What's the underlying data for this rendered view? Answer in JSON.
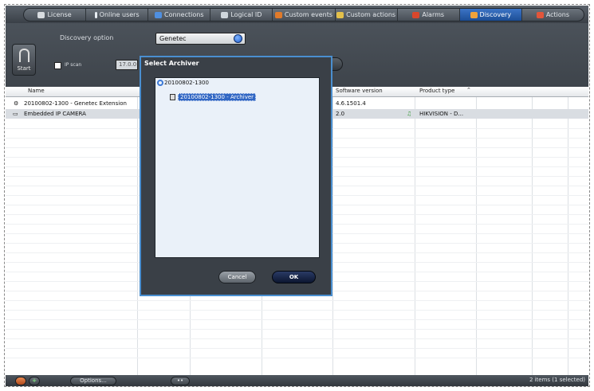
{
  "tabs": [
    {
      "label": "License",
      "icon": "license-icon",
      "color": "#d8dce0"
    },
    {
      "label": "Online users",
      "icon": "user-icon",
      "color": "#e8eef4"
    },
    {
      "label": "Connections",
      "icon": "connections-icon",
      "color": "#4f8fe0"
    },
    {
      "label": "Logical ID",
      "icon": "logical-id-icon",
      "color": "#cfd6dc"
    },
    {
      "label": "Custom events",
      "icon": "custom-events-icon",
      "color": "#e07a2a"
    },
    {
      "label": "Custom actions",
      "icon": "custom-actions-icon",
      "color": "#e3c04a"
    },
    {
      "label": "Alarms",
      "icon": "alarm-icon",
      "color": "#d9472c"
    },
    {
      "label": "Discovery",
      "icon": "discovery-icon",
      "color": "#f0a23a",
      "active": true
    },
    {
      "label": "Actions",
      "icon": "actions-icon",
      "color": "#e2553a"
    }
  ],
  "options": {
    "discovery_label": "Discovery option",
    "discovery_value": "Genetec",
    "start_label": "Start",
    "ipscan_label": "IP scan",
    "ip_field": "17.0.0"
  },
  "grid": {
    "columns": {
      "name": "Name",
      "software": "Software version",
      "product": "Product type"
    },
    "rows": [
      {
        "name": "20100802-1300 - Genetec Extension",
        "software": "4.6.1501.4",
        "product": ""
      },
      {
        "name": "Embedded IP CAMERA",
        "software": "2.0",
        "product": "HIKVISION - D..."
      }
    ]
  },
  "dialog": {
    "title": "Select Archiver",
    "root": "20100802-1300",
    "child": "20100802-1300 - Archiver",
    "cancel": "Cancel",
    "ok": "OK"
  },
  "status": {
    "options_button": "Options...",
    "summary": "2 items (1 selected)"
  }
}
